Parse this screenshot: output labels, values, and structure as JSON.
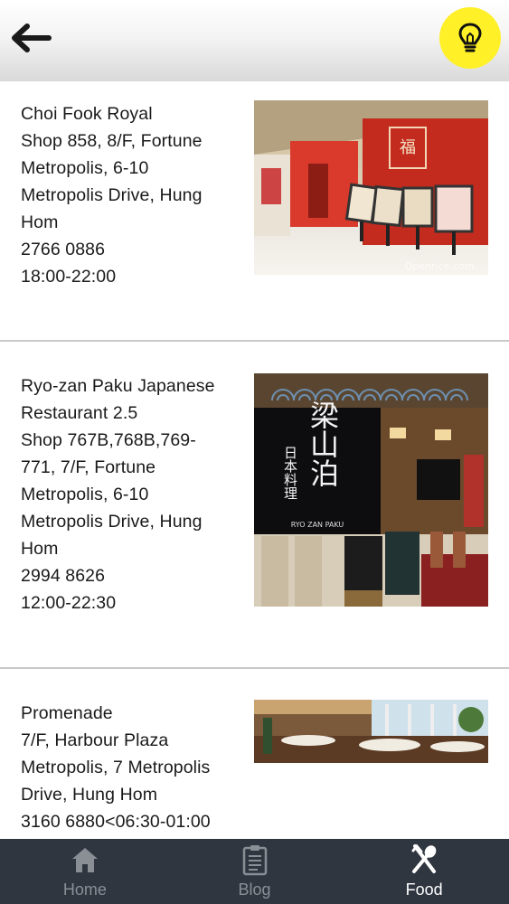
{
  "header": {
    "back_icon": "arrow-left-icon",
    "tip_icon": "lightbulb-icon",
    "tip_color": "#fff028"
  },
  "restaurants": [
    {
      "lines": [
        "Choi Fook Royal",
        "Shop 858, 8/F, Fortune",
        "Metropolis, 6-10",
        "Metropolis Drive, Hung",
        "Hom",
        "2766 0886",
        "18:00-22:00"
      ],
      "watermark": "Openrice.com"
    },
    {
      "lines": [
        "Ryo-zan Paku Japanese",
        "Restaurant 2.5",
        "Shop 767B,768B,769-",
        "771, 7/F, Fortune",
        "Metropolis, 6-10",
        "Metropolis Drive, Hung",
        "Hom",
        "2994 8626",
        "12:00-22:30"
      ],
      "sign_text": "梁山泊",
      "sign_sub": "日本料理",
      "sign_roman": "RYO ZAN PAKU"
    },
    {
      "lines": [
        "Promenade",
        "7/F, Harbour Plaza",
        "Metropolis, 7 Metropolis",
        "Drive, Hung Hom",
        "3160 6880<06:30-01:00"
      ]
    }
  ],
  "tabs": [
    {
      "label": "Home",
      "icon": "home-icon",
      "active": false
    },
    {
      "label": "Blog",
      "icon": "clipboard-icon",
      "active": false
    },
    {
      "label": "Food",
      "icon": "fork-knife-icon",
      "active": true
    }
  ],
  "colors": {
    "tabbar_bg": "#2f3640",
    "tab_inactive": "#8a8f96",
    "tab_active": "#ffffff"
  }
}
